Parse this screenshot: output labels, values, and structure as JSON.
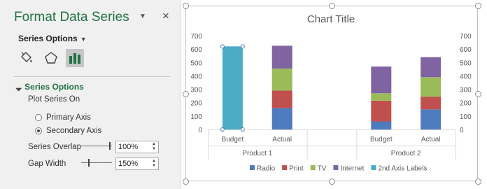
{
  "pane": {
    "title": "Format Data Series",
    "close_glyph": "×",
    "dropdown_glyph": "▼",
    "series_options_label": "Series Options",
    "tabs": [
      {
        "icon": "paint-bucket-icon"
      },
      {
        "icon": "pentagon-icon"
      },
      {
        "icon": "bar-chart-icon",
        "active": true
      }
    ],
    "section": {
      "header": "Series Options",
      "plot_series_on": "Plot Series On",
      "primary_axis": "Primary Axis",
      "secondary_axis": "Secondary Axis",
      "selected_axis": "secondary",
      "overlap_label": "Series Overlap",
      "overlap_value": "100%",
      "gap_label": "Gap Width",
      "gap_value": "150%"
    }
  },
  "chart": {
    "title": "Chart Title",
    "legend": [
      {
        "name": "Radio",
        "color": "#4e7bbd"
      },
      {
        "name": "Print",
        "color": "#c0504d"
      },
      {
        "name": "TV",
        "color": "#9bbb59"
      },
      {
        "name": "Internet",
        "color": "#8064a2"
      },
      {
        "name": "2nd Axis Labels",
        "color": "#4bacc6"
      }
    ]
  },
  "chart_data": {
    "type": "bar",
    "title": "Chart Title",
    "stacked": true,
    "ylim": [
      0,
      700
    ],
    "yticks": [
      0,
      100,
      200,
      300,
      400,
      500,
      600,
      700
    ],
    "secondary_ylim": [
      0,
      700
    ],
    "groups": [
      {
        "name": "Product 1",
        "categories": [
          "Budget",
          "Actual"
        ]
      },
      {
        "name": "Product 2",
        "categories": [
          "Budget",
          "Actual"
        ]
      }
    ],
    "categories": [
      "Budget",
      "Actual",
      "",
      "Budget",
      "Actual"
    ],
    "series": [
      {
        "name": "Radio",
        "color": "#4e7bbd",
        "values": [
          0,
          160,
          0,
          60,
          150
        ]
      },
      {
        "name": "Print",
        "color": "#c0504d",
        "values": [
          0,
          130,
          0,
          155,
          95
        ]
      },
      {
        "name": "TV",
        "color": "#9bbb59",
        "values": [
          0,
          165,
          0,
          55,
          145
        ]
      },
      {
        "name": "Internet",
        "color": "#8064a2",
        "values": [
          0,
          170,
          0,
          200,
          150
        ]
      },
      {
        "name": "2nd Axis Labels",
        "color": "#4bacc6",
        "axis": "secondary",
        "values": [
          620,
          0,
          0,
          0,
          0
        ]
      }
    ],
    "legend_position": "bottom",
    "grid": false
  }
}
